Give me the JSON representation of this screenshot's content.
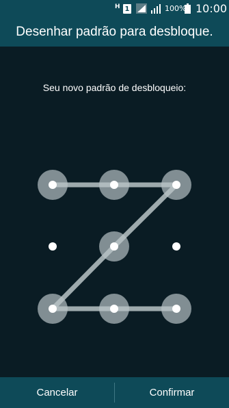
{
  "colors": {
    "title_bar": "#0e4a58",
    "background": "#0a1c24",
    "node_ring": "#a9b4b8",
    "path_line": "#b9c3c6",
    "dot": "#ffffff"
  },
  "status_bar": {
    "network_type": "H",
    "sim_slot": "1",
    "signal_icon_1": "signal-icon",
    "signal_icon_2": "signal-icon",
    "battery_percent": "100%",
    "battery_icon": "battery-full-icon",
    "time": "10:00"
  },
  "title_bar": {
    "title": "Desenhar padrão para desbloque."
  },
  "prompt": "Seu novo padrão de desbloqueio:",
  "pattern": {
    "nodes": [
      {
        "row": 1,
        "col": 1,
        "selected": true
      },
      {
        "row": 1,
        "col": 2,
        "selected": true
      },
      {
        "row": 1,
        "col": 3,
        "selected": true
      },
      {
        "row": 2,
        "col": 1,
        "selected": false
      },
      {
        "row": 2,
        "col": 2,
        "selected": true
      },
      {
        "row": 2,
        "col": 3,
        "selected": false
      },
      {
        "row": 3,
        "col": 1,
        "selected": true
      },
      {
        "row": 3,
        "col": 2,
        "selected": true
      },
      {
        "row": 3,
        "col": 3,
        "selected": true
      }
    ],
    "drawn_sequence": [
      1,
      2,
      3,
      5,
      7,
      8,
      9
    ]
  },
  "bottom_bar": {
    "cancel_label": "Cancelar",
    "confirm_label": "Confirmar"
  }
}
